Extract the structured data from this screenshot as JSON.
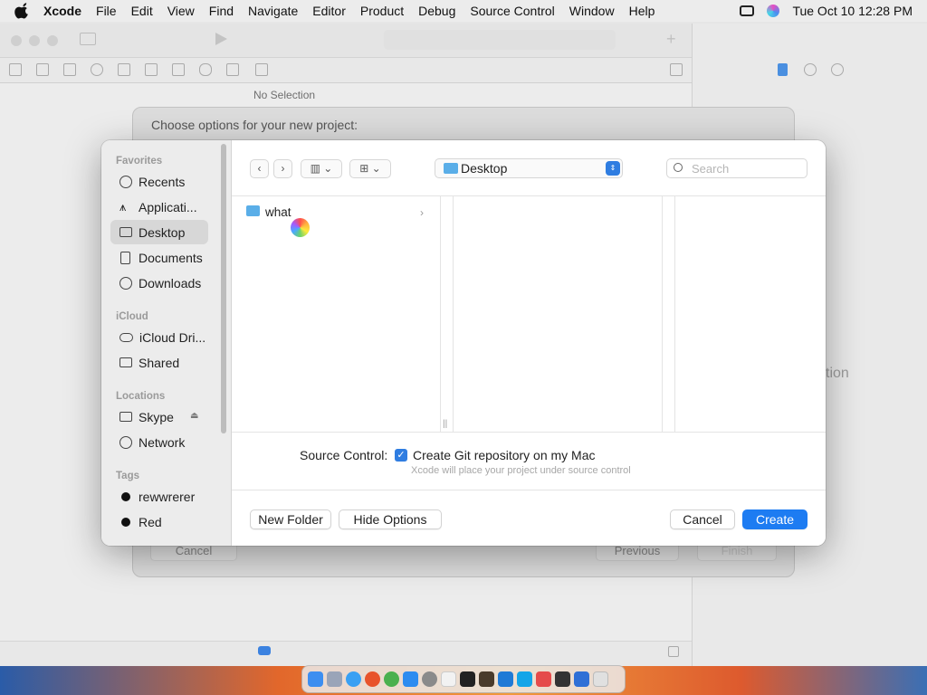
{
  "menubar": {
    "app": "Xcode",
    "items": [
      "File",
      "Edit",
      "View",
      "Find",
      "Navigate",
      "Editor",
      "Product",
      "Debug",
      "Source Control",
      "Window",
      "Help"
    ],
    "clock": "Tue Oct 10  12:28 PM"
  },
  "xcode": {
    "no_selection": "No Selection",
    "bg_fragment": "tion"
  },
  "sheet": {
    "title": "Choose options for your new project:",
    "cancel": "Cancel",
    "previous": "Previous",
    "finish": "Finish"
  },
  "sidebar": {
    "favorites_header": "Favorites",
    "favorites": [
      "Recents",
      "Applicati...",
      "Desktop",
      "Documents",
      "Downloads"
    ],
    "icloud_header": "iCloud",
    "icloud": [
      "iCloud Dri...",
      "Shared"
    ],
    "locations_header": "Locations",
    "locations": [
      "Skype",
      "Network"
    ],
    "tags_header": "Tags",
    "tags": [
      "rewwrerer",
      "Red"
    ]
  },
  "toolbar": {
    "location": "Desktop",
    "search_placeholder": "Search"
  },
  "browser": {
    "items": [
      "what"
    ]
  },
  "options": {
    "source_control_label": "Source Control:",
    "git_checkbox_label": "Create Git repository on my Mac",
    "git_note": "Xcode will place your project under source control"
  },
  "buttons": {
    "new_folder": "New Folder",
    "hide_options": "Hide Options",
    "cancel": "Cancel",
    "create": "Create"
  },
  "colors": {
    "accent": "#1d7cf2",
    "folder": "#5aaee8"
  }
}
